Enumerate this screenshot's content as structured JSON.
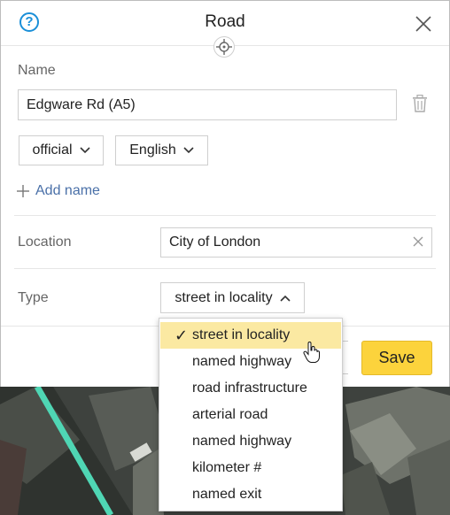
{
  "header": {
    "title": "Road"
  },
  "name_section": {
    "label": "Name",
    "name_value": "Edgware Rd (A5)",
    "name_type": "official",
    "language": "English",
    "add_name_label": "Add name"
  },
  "location": {
    "label": "Location",
    "value": "City of London"
  },
  "type": {
    "label": "Type",
    "selected": "street in locality",
    "options": [
      "street in locality",
      "named highway",
      "road infrastructure",
      "arterial road",
      "named highway",
      "kilometer #",
      "named exit"
    ]
  },
  "footer": {
    "save_label": "Save"
  },
  "colors": {
    "accent": "#1a8fd8",
    "save": "#fcd33c",
    "selected_option": "#fbe9a2",
    "road_line": "#4fd6b4"
  },
  "icons": [
    "help-icon",
    "target-icon",
    "close-icon",
    "trash-icon",
    "chevron-down-icon",
    "plus-icon",
    "clear-icon",
    "chevron-up-icon",
    "check-icon",
    "hand-cursor-icon"
  ]
}
